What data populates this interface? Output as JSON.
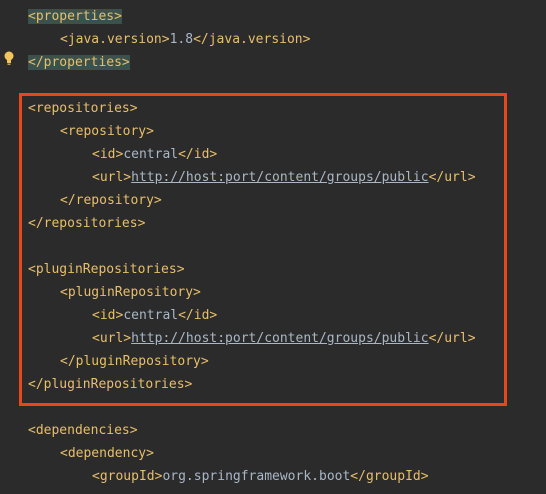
{
  "editor": {
    "lines": [
      {
        "indent": 28,
        "parts": [
          {
            "k": "tag",
            "t": "<properties>",
            "hl": true
          }
        ]
      },
      {
        "indent": 60,
        "parts": [
          {
            "k": "tag",
            "t": "<java.version>"
          },
          {
            "k": "text",
            "t": "1.8"
          },
          {
            "k": "tag",
            "t": "</java.version>"
          }
        ]
      },
      {
        "indent": 28,
        "parts": [
          {
            "k": "tag",
            "t": "</properties>",
            "hl": true
          }
        ]
      },
      {
        "indent": 28,
        "parts": []
      },
      {
        "indent": 28,
        "parts": [
          {
            "k": "tag",
            "t": "<repositories>"
          }
        ]
      },
      {
        "indent": 60,
        "parts": [
          {
            "k": "tag",
            "t": "<repository>"
          }
        ]
      },
      {
        "indent": 92,
        "parts": [
          {
            "k": "tag",
            "t": "<id>"
          },
          {
            "k": "text",
            "t": "central"
          },
          {
            "k": "tag",
            "t": "</id>"
          }
        ]
      },
      {
        "indent": 92,
        "parts": [
          {
            "k": "tag",
            "t": "<url>"
          },
          {
            "k": "url",
            "t": "http://host:port/content/groups/public"
          },
          {
            "k": "tag",
            "t": "</url>"
          }
        ]
      },
      {
        "indent": 60,
        "parts": [
          {
            "k": "tag",
            "t": "</repository>"
          }
        ]
      },
      {
        "indent": 28,
        "parts": [
          {
            "k": "tag",
            "t": "</repositories>"
          }
        ]
      },
      {
        "indent": 28,
        "parts": []
      },
      {
        "indent": 28,
        "parts": [
          {
            "k": "tag",
            "t": "<pluginRepositories>"
          }
        ]
      },
      {
        "indent": 60,
        "parts": [
          {
            "k": "tag",
            "t": "<pluginRepository>"
          }
        ]
      },
      {
        "indent": 92,
        "parts": [
          {
            "k": "tag",
            "t": "<id>"
          },
          {
            "k": "text",
            "t": "central"
          },
          {
            "k": "tag",
            "t": "</id>"
          }
        ]
      },
      {
        "indent": 92,
        "parts": [
          {
            "k": "tag",
            "t": "<url>"
          },
          {
            "k": "url",
            "t": "http://host:port/content/groups/public"
          },
          {
            "k": "tag",
            "t": "</url>"
          }
        ]
      },
      {
        "indent": 60,
        "parts": [
          {
            "k": "tag",
            "t": "</pluginRepository>"
          }
        ]
      },
      {
        "indent": 28,
        "parts": [
          {
            "k": "tag",
            "t": "</pluginRepositories>"
          }
        ]
      },
      {
        "indent": 28,
        "parts": []
      },
      {
        "indent": 28,
        "parts": [
          {
            "k": "tag",
            "t": "<dependencies>"
          }
        ]
      },
      {
        "indent": 60,
        "parts": [
          {
            "k": "tag",
            "t": "<dependency>"
          }
        ]
      },
      {
        "indent": 92,
        "parts": [
          {
            "k": "tag",
            "t": "<groupId>"
          },
          {
            "k": "text",
            "t": "org.springframework.boot"
          },
          {
            "k": "tag",
            "t": "</groupId>"
          }
        ]
      }
    ]
  },
  "colors": {
    "background": "#2b2b2b",
    "tag": "#e8bf6a",
    "text": "#a9b7c6",
    "tag_highlight": "#3b514d",
    "annotation_box": "#e8471a",
    "bulb": "#f2c55c"
  },
  "icons": {
    "gutter": "lightbulb-icon"
  }
}
